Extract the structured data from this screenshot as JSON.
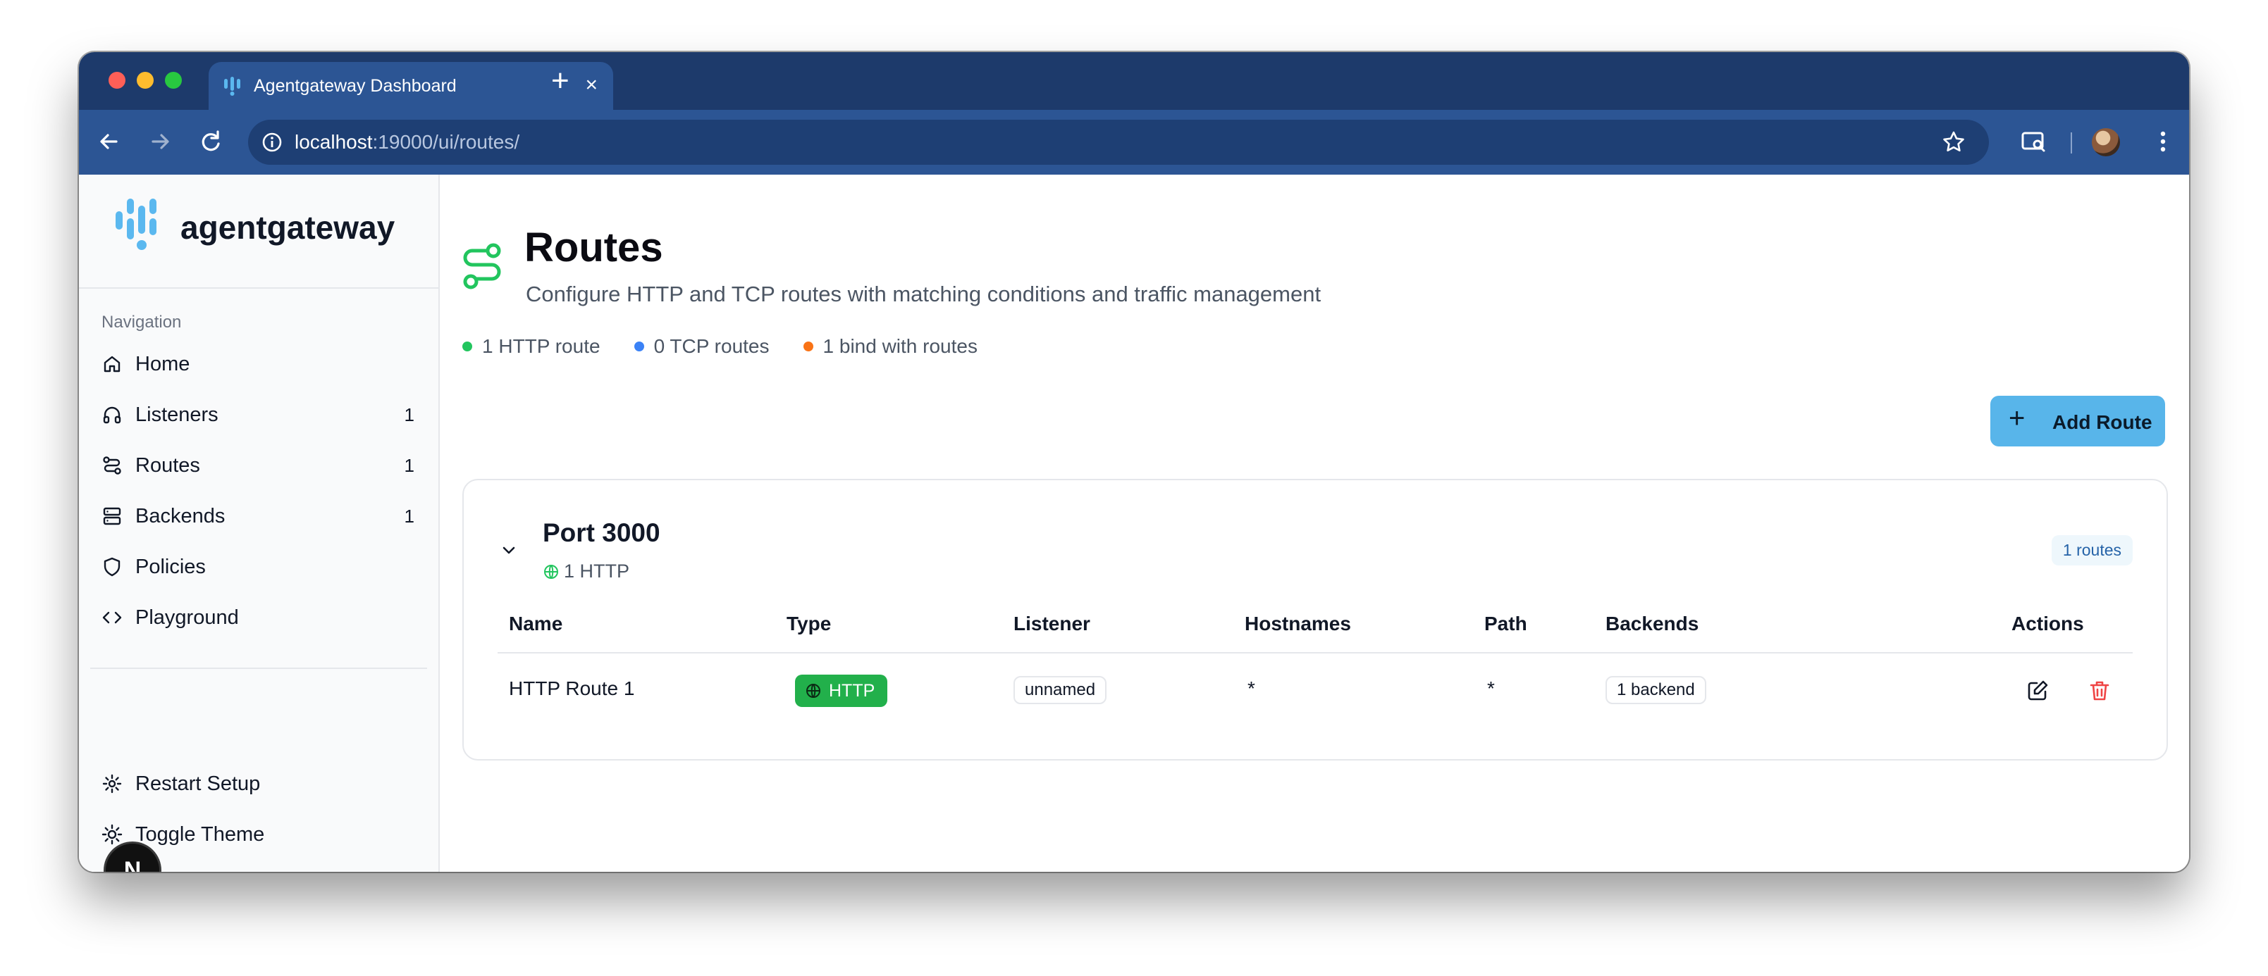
{
  "browser": {
    "tab_title": "Agentgateway Dashboard",
    "tab_close": "×",
    "new_tab": "+",
    "url_host": "localhost",
    "url_rest": ":19000/ui/routes/"
  },
  "sidebar": {
    "brand": "agentgateway",
    "nav_heading": "Navigation",
    "items": [
      {
        "label": "Home",
        "icon": "home-icon",
        "count": ""
      },
      {
        "label": "Listeners",
        "icon": "headphones-icon",
        "count": "1"
      },
      {
        "label": "Routes",
        "icon": "route-icon",
        "count": "1"
      },
      {
        "label": "Backends",
        "icon": "server-icon",
        "count": "1"
      },
      {
        "label": "Policies",
        "icon": "shield-icon",
        "count": ""
      },
      {
        "label": "Playground",
        "icon": "code-icon",
        "count": ""
      }
    ],
    "footer": [
      {
        "label": "Restart Setup",
        "icon": "gear-icon"
      },
      {
        "label": "Toggle Theme",
        "icon": "sun-icon"
      }
    ],
    "nextjs_badge": "N"
  },
  "page": {
    "title": "Routes",
    "subtitle": "Configure HTTP and TCP routes with matching conditions and traffic management",
    "stats": [
      {
        "text": "1 HTTP route",
        "color": "#22c55e"
      },
      {
        "text": "0 TCP routes",
        "color": "#3b82f6"
      },
      {
        "text": "1 bind with routes",
        "color": "#f97316"
      }
    ],
    "add_button": "Add Route"
  },
  "port_group": {
    "title": "Port 3000",
    "subtitle": "1 HTTP",
    "badge": "1 routes",
    "columns": [
      "Name",
      "Type",
      "Listener",
      "Hostnames",
      "Path",
      "Backends",
      "Actions"
    ],
    "rows": [
      {
        "name": "HTTP Route 1",
        "type": "HTTP",
        "listener": "unnamed",
        "hostnames": "*",
        "path": "*",
        "backends": "1 backend"
      }
    ]
  },
  "colors": {
    "accent": "#58b5ea",
    "http_green": "#22b04b",
    "route_icon": "#22c55e",
    "delete_red": "#ef4444",
    "chrome_dark": "#1d3a6b",
    "chrome_toolbar": "#2c5594"
  }
}
